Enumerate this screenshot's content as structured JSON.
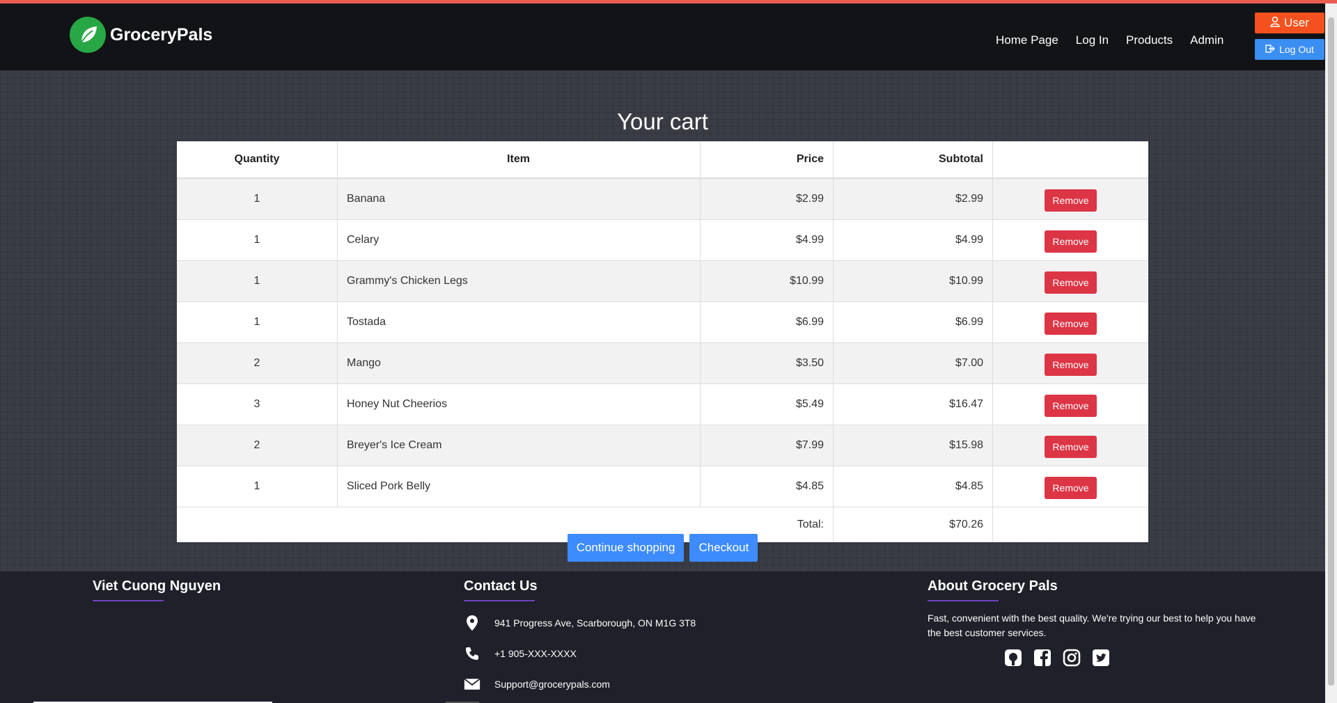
{
  "brand": {
    "name": "GroceryPals"
  },
  "nav": {
    "items": [
      "Home Page",
      "Log In",
      "Products",
      "Admin"
    ],
    "user_label": "User",
    "logout_label": "Log Out"
  },
  "cart": {
    "title": "Your cart",
    "headers": {
      "quantity": "Quantity",
      "item": "Item",
      "price": "Price",
      "subtotal": "Subtotal"
    },
    "rows": [
      {
        "qty": "1",
        "item": "Banana",
        "price": "$2.99",
        "subtotal": "$2.99",
        "action": "Remove"
      },
      {
        "qty": "1",
        "item": "Celary",
        "price": "$4.99",
        "subtotal": "$4.99",
        "action": "Remove"
      },
      {
        "qty": "1",
        "item": "Grammy's Chicken Legs",
        "price": "$10.99",
        "subtotal": "$10.99",
        "action": "Remove"
      },
      {
        "qty": "1",
        "item": "Tostada",
        "price": "$6.99",
        "subtotal": "$6.99",
        "action": "Remove"
      },
      {
        "qty": "2",
        "item": "Mango",
        "price": "$3.50",
        "subtotal": "$7.00",
        "action": "Remove"
      },
      {
        "qty": "3",
        "item": "Honey Nut Cheerios",
        "price": "$5.49",
        "subtotal": "$16.47",
        "action": "Remove"
      },
      {
        "qty": "2",
        "item": "Breyer's Ice Cream",
        "price": "$7.99",
        "subtotal": "$15.98",
        "action": "Remove"
      },
      {
        "qty": "1",
        "item": "Sliced Pork Belly",
        "price": "$4.85",
        "subtotal": "$4.85",
        "action": "Remove"
      }
    ],
    "total_label": "Total:",
    "total_value": "$70.26",
    "continue_label": "Continue shopping",
    "checkout_label": "Checkout"
  },
  "footer": {
    "col1_title": "Viet Cuong Nguyen",
    "contact_title": "Contact Us",
    "address": "941 Progress Ave, Scarborough, ON M1G 3T8",
    "phone": "+1 905-XXX-XXXX",
    "email": "Support@grocerypals.com",
    "about_title": "About Grocery Pals",
    "about_text": "Fast, convenient with the best quality. We're trying our best to help you have the best customer services.",
    "socials": [
      "github-icon",
      "facebook-icon",
      "instagram-icon",
      "twitter-icon"
    ]
  },
  "colors": {
    "accent_red": "#dc3545",
    "accent_blue": "#3d8bfd",
    "user_orange": "#f4511e",
    "footer_underline": "#6f42c1"
  }
}
